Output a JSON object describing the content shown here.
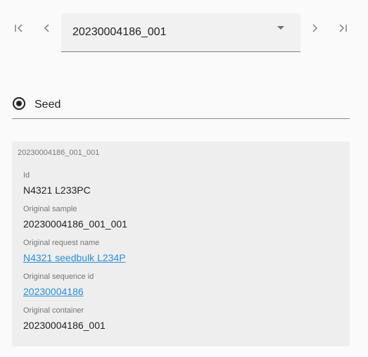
{
  "navigation": {
    "first_icon": "first-page-icon",
    "prev_icon": "chevron-left-icon",
    "next_icon": "chevron-right-icon",
    "last_icon": "last-page-icon"
  },
  "selector": {
    "value": "20230004186_001",
    "icon": "arrow-drop-down-icon"
  },
  "type_option": {
    "label": "Seed",
    "selected": true
  },
  "details": {
    "title": "20230004186_001_001",
    "fields": [
      {
        "label": "Id",
        "value": "N4321 L233PC"
      },
      {
        "label": "Original sample",
        "value": "20230004186_001_001"
      },
      {
        "label": "Original request name",
        "value": "N4321 seedbulk L234P"
      },
      {
        "label": "Original sequence id",
        "value": "20230004186"
      },
      {
        "label": "Original container",
        "value": "20230004186_001"
      }
    ]
  },
  "colors": {
    "link": "#2b8fd6",
    "card_background": "#eeeeee",
    "page_background": "#fafafa"
  }
}
